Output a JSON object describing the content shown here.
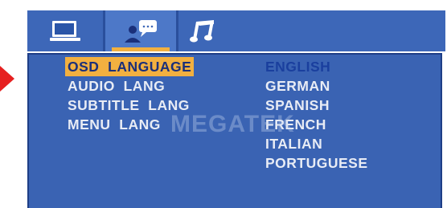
{
  "tabs": [
    {
      "icon": "monitor-icon",
      "active": false
    },
    {
      "icon": "user-chat-icon",
      "active": true
    },
    {
      "icon": "music-note-icon",
      "active": false
    }
  ],
  "menu": {
    "items": [
      {
        "label": "OSD  LANGUAGE",
        "selected": true
      },
      {
        "label": "AUDIO  LANG",
        "selected": false
      },
      {
        "label": "SUBTITLE  LANG",
        "selected": false
      },
      {
        "label": "MENU  LANG",
        "selected": false
      }
    ]
  },
  "options": {
    "items": [
      {
        "label": "ENGLISH",
        "selected": true
      },
      {
        "label": "GERMAN",
        "selected": false
      },
      {
        "label": "SPANISH",
        "selected": false
      },
      {
        "label": "FRENCH",
        "selected": false
      },
      {
        "label": "ITALIAN",
        "selected": false
      },
      {
        "label": "PORTUGUESE",
        "selected": false
      }
    ]
  },
  "watermark": "MEGATEK",
  "colors": {
    "tab_bar": "#3d67b8",
    "panel": "#3a63b3",
    "highlight": "#f2b040",
    "text": "#e8ecf5",
    "pointer": "#e62020"
  }
}
